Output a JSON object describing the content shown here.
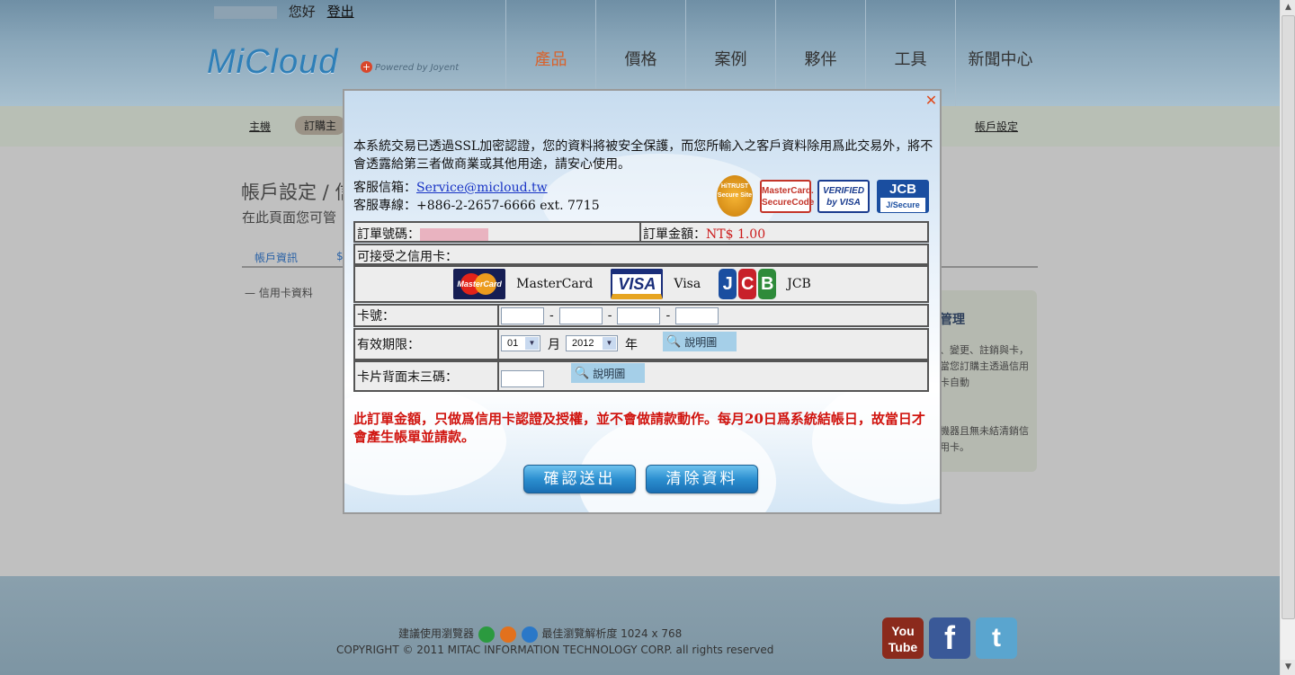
{
  "header": {
    "greeting": "您好",
    "logout": "登出",
    "logo": "MiCloud",
    "logo_sub": "Powered by Joyent",
    "nav": [
      "產品",
      "價格",
      "案例",
      "夥伴",
      "工具",
      "新聞中心"
    ]
  },
  "subnav": {
    "host": "主機",
    "order": "訂購主",
    "account": "帳戶設定"
  },
  "content": {
    "title": "帳戶設定 / 信",
    "subtitle": "在此頁面您可管",
    "tab1": "帳戶資訊",
    "tab2": "$",
    "fieldset": "信用卡資料",
    "side_heading": "管理",
    "side_p1": "、變更、註銷與卡，當您訂購主透過信用卡自動",
    "side_p2": "機器且無未結清銷信用卡。"
  },
  "modal": {
    "intro": "本系統交易已透過SSL加密認證，您的資料將被安全保護，而您所輸入之客戶資料除用爲此交易外，將不會透露給第三者做商業或其他用途，請安心使用。",
    "email_label": "客服信箱：",
    "email": "Service@micloud.tw",
    "phone_label": "客服專線：",
    "phone": "+886-2-2657-6666 ext. 7715",
    "badges": {
      "trust": "HiTRUST Secure Site",
      "mastercard": "MasterCard. SecureCode",
      "visa": "VERIFIED by VISA",
      "jcb": "JCB",
      "jcb_sub": "J/Secure"
    },
    "order_no_label": "訂單號碼：",
    "amount_label": "訂單金額：",
    "amount": "NT$ 1.00",
    "accepted_label": "可接受之信用卡：",
    "cards": [
      {
        "name": "MasterCard",
        "logo": "MasterCard"
      },
      {
        "name": "Visa",
        "logo": "VISA"
      },
      {
        "name": "JCB",
        "logo": "JCB"
      }
    ],
    "card_no_label": "卡號：",
    "expiry_label": "有效期限：",
    "month": "01",
    "month_unit": "月",
    "year": "2012",
    "year_unit": "年",
    "cvv_label": "卡片背面末三碼：",
    "help": "說明圖",
    "notice": "此訂單金額，只做爲信用卡認證及授權，並不會做請款動作。每月20日爲系統結帳日，故當日才會產生帳單並請款。",
    "submit": "確認送出",
    "clear": "清除資料"
  },
  "footer": {
    "browser_text": "建議使用瀏覽器",
    "resolution": "最佳瀏覽解析度 1024 x 768",
    "copyright": "COPYRIGHT © 2011 MITAC INFORMATION TECHNOLOGY CORP. all rights reserved",
    "social": [
      "You Tube",
      "f",
      "t"
    ]
  }
}
